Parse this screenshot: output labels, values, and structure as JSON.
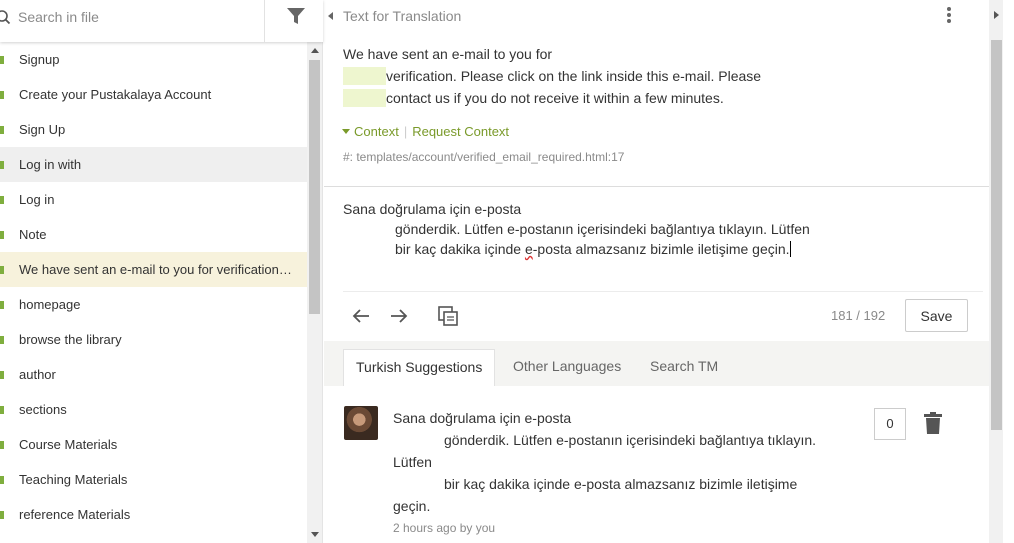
{
  "search": {
    "placeholder": "Search in file"
  },
  "units": [
    {
      "label": "Signup"
    },
    {
      "label": "Create your Pustakalaya Account"
    },
    {
      "label": "Sign Up"
    },
    {
      "label": "Log in with"
    },
    {
      "label": "Log in"
    },
    {
      "label": "Note"
    },
    {
      "label": "We have sent an e-mail to you for verification. Please click on the link inside this e-mail."
    },
    {
      "label": "homepage"
    },
    {
      "label": "browse the library"
    },
    {
      "label": "author"
    },
    {
      "label": "sections"
    },
    {
      "label": "Course Materials"
    },
    {
      "label": "Teaching Materials"
    },
    {
      "label": "reference Materials"
    }
  ],
  "source": {
    "title": "Text for Translation",
    "lines": [
      "We have sent an e-mail to you for",
      "verification. Please click on the link inside this e-mail. Please",
      "contact us if you do not receive it within a few minutes."
    ],
    "context_label": "Context",
    "request_context_label": "Request Context",
    "context_path": "#: templates/account/verified_email_required.html:17"
  },
  "translation": {
    "line1": "Sana doğrulama için e-posta",
    "line2": "gönderdik. Lütfen e-postanın içerisindeki bağlantıya tıklayın. Lütfen",
    "line3_before": "bir kaç dakika içinde ",
    "line3_misspelled": "e",
    "line3_after": "-posta almazsanız bizimle iletişime geçin."
  },
  "toolbar": {
    "counter": "181 / 192",
    "save_label": "Save"
  },
  "suggestion_tabs": [
    {
      "label": "Turkish Suggestions"
    },
    {
      "label": "Other Languages"
    },
    {
      "label": "Search TM"
    }
  ],
  "suggestion": {
    "lines": [
      "Sana doğrulama için e-posta",
      "gönderdik. Lütfen e-postanın içerisindeki bağlantıya tıklayın.",
      "Lütfen",
      "bir kaç dakika içinde e-posta almazsanız bizimle iletişime",
      "geçin."
    ],
    "meta": "2 hours ago by you",
    "votes": "0"
  },
  "colors": {
    "accent": "#7fae3e",
    "active_row": "#f7f2dc",
    "highlight": "#eef6cf"
  },
  "icons": [
    "search-icon",
    "filter-icon",
    "kebab-menu-icon",
    "arrow-left-icon",
    "arrow-right-icon",
    "copy-source-icon",
    "trash-icon"
  ]
}
